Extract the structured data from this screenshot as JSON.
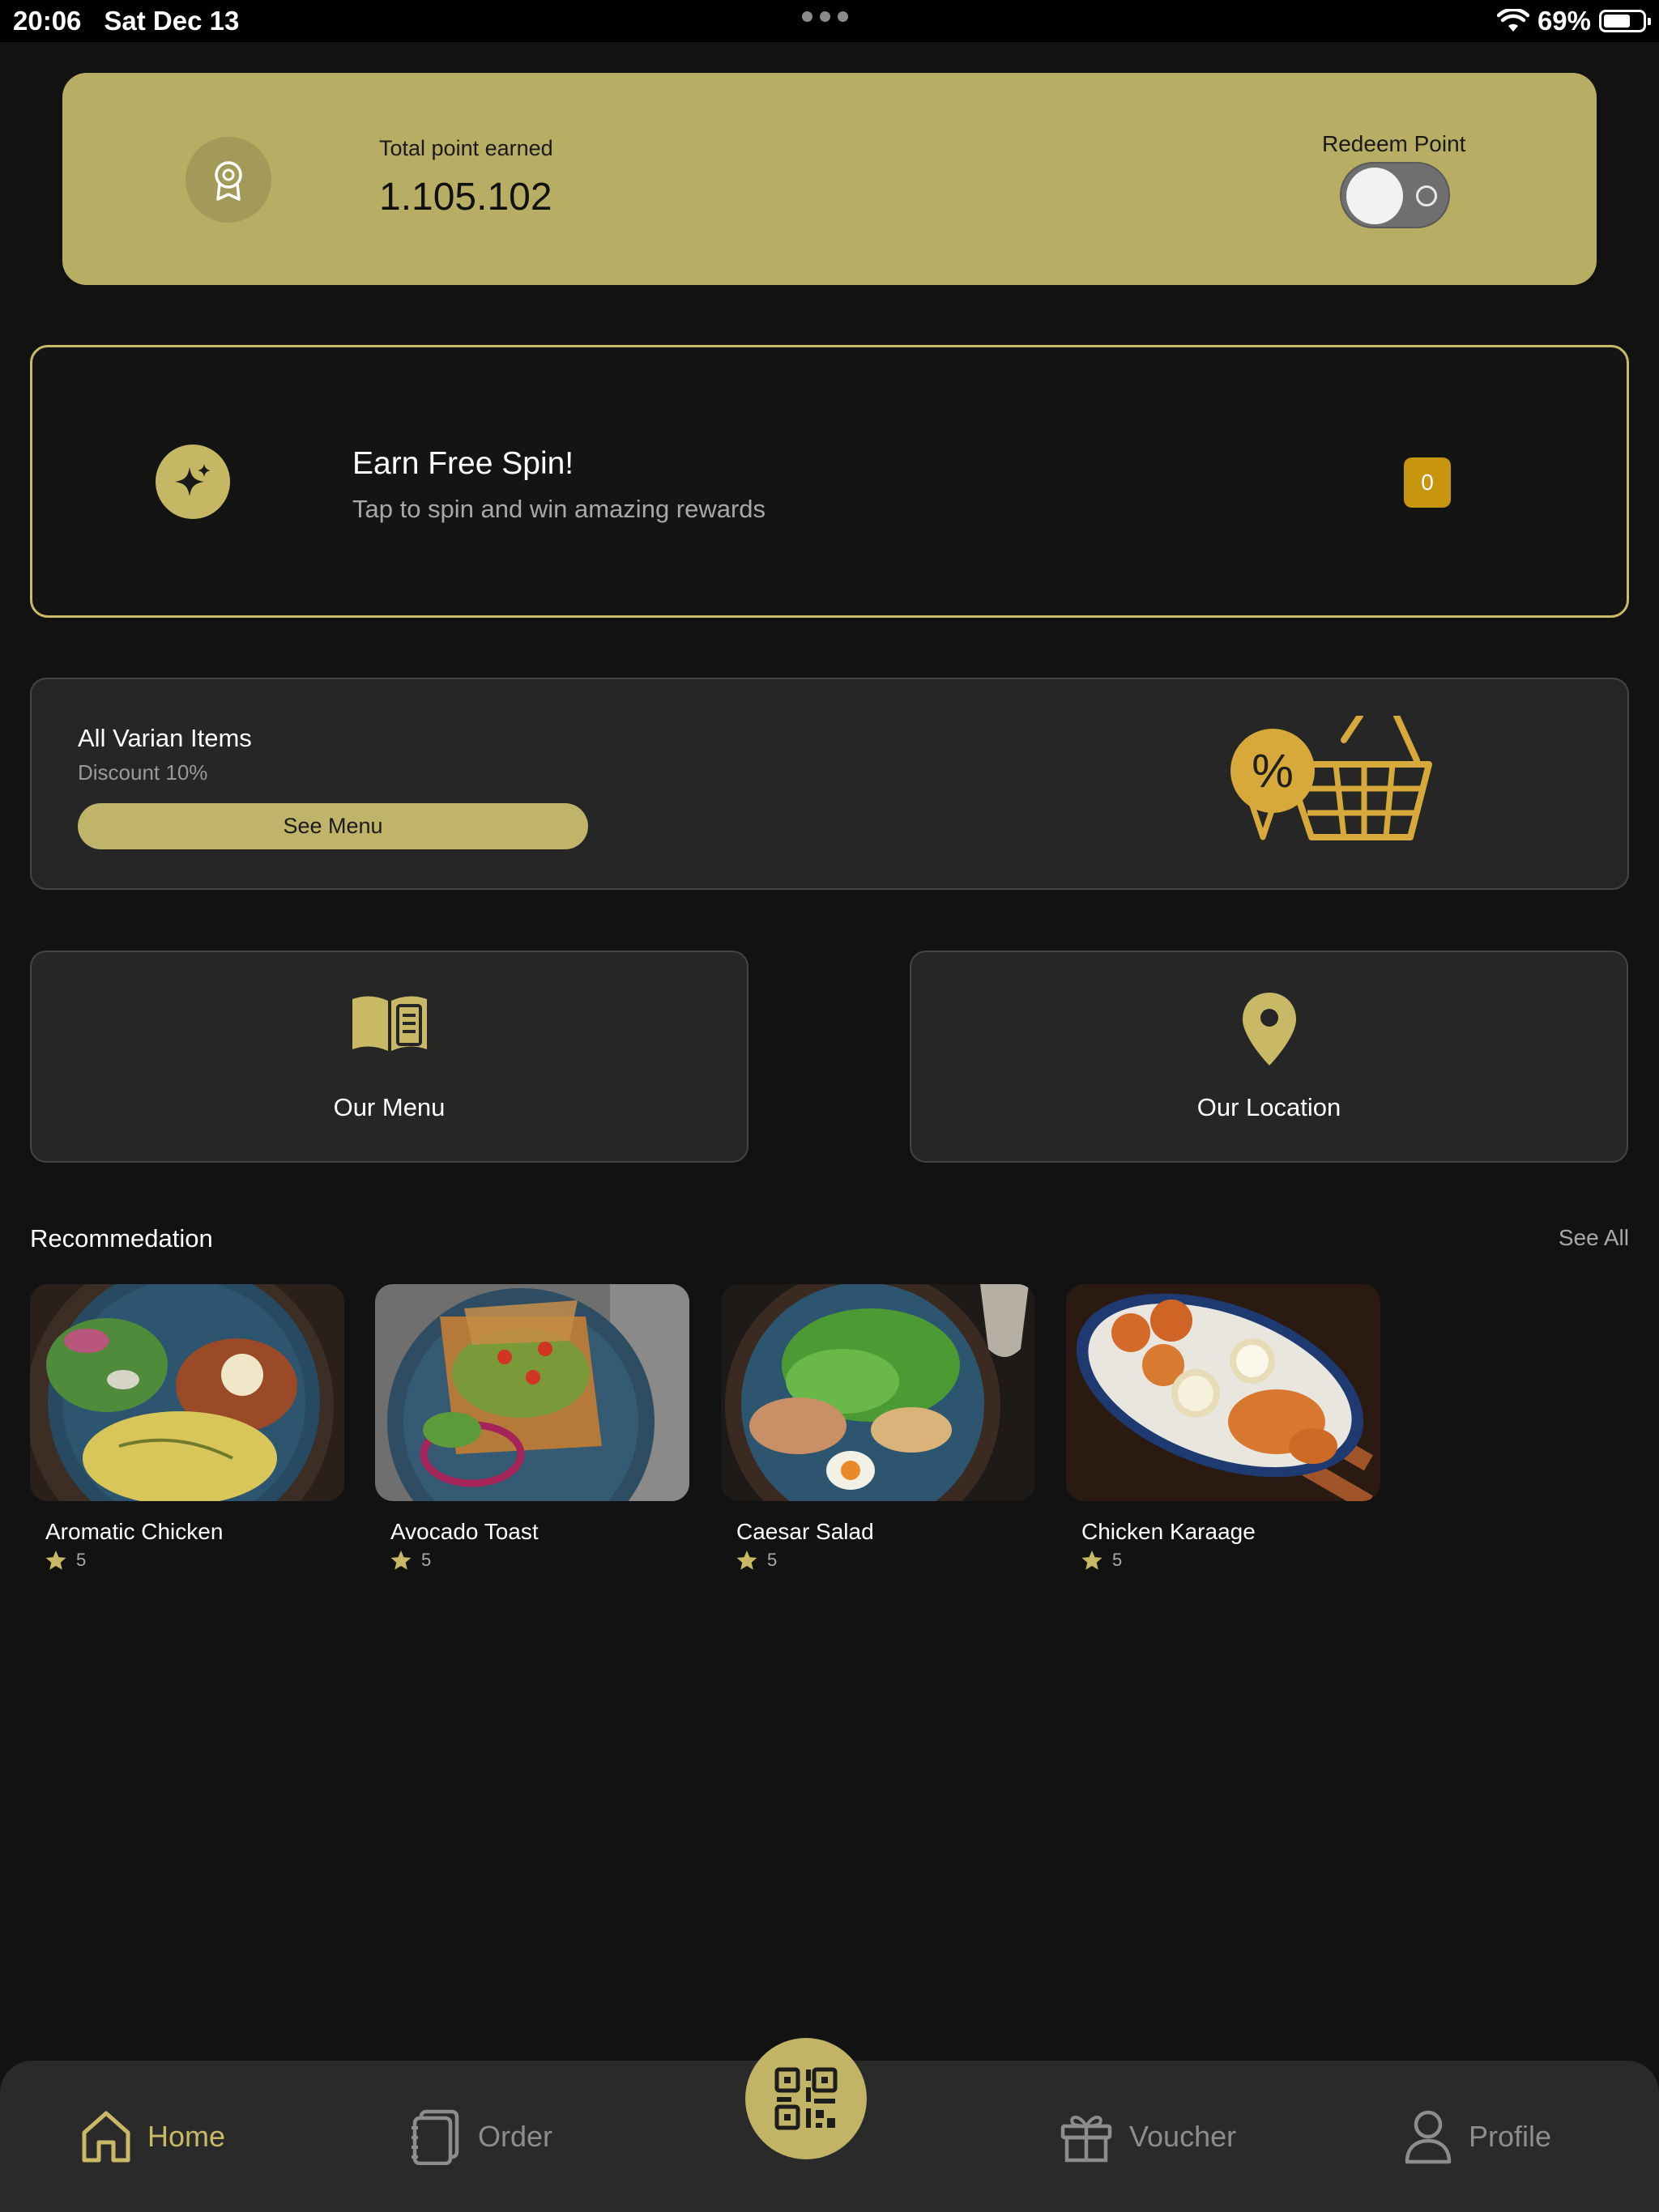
{
  "status_bar": {
    "time": "20:06",
    "date": "Sat Dec 13",
    "battery": "69%"
  },
  "points": {
    "label": "Total point earned",
    "value": "1.105.102",
    "redeem_label": "Redeem Point",
    "redeem_toggle_on": false
  },
  "spin": {
    "title": "Earn Free Spin!",
    "subtitle": "Tap to spin and win amazing rewards",
    "count": "0"
  },
  "promo": {
    "title": "All Varian Items",
    "subtitle": "Discount 10%",
    "button": "See Menu",
    "badge_symbol": "%"
  },
  "tiles": {
    "menu": "Our Menu",
    "location": "Our Location"
  },
  "recommendation": {
    "title": "Recommedation",
    "see_all": "See All",
    "items": [
      {
        "name": "Aromatic Chicken",
        "rating": "5"
      },
      {
        "name": "Avocado Toast",
        "rating": "5"
      },
      {
        "name": "Caesar Salad",
        "rating": "5"
      },
      {
        "name": "Chicken Karaage",
        "rating": "5"
      }
    ]
  },
  "nav": {
    "home": "Home",
    "order": "Order",
    "voucher": "Voucher",
    "profile": "Profile"
  },
  "colors": {
    "accent": "#c9b967",
    "points_card": "#b8ad64",
    "background": "#121212",
    "card": "#262626",
    "spin_badge": "#c8960e"
  }
}
